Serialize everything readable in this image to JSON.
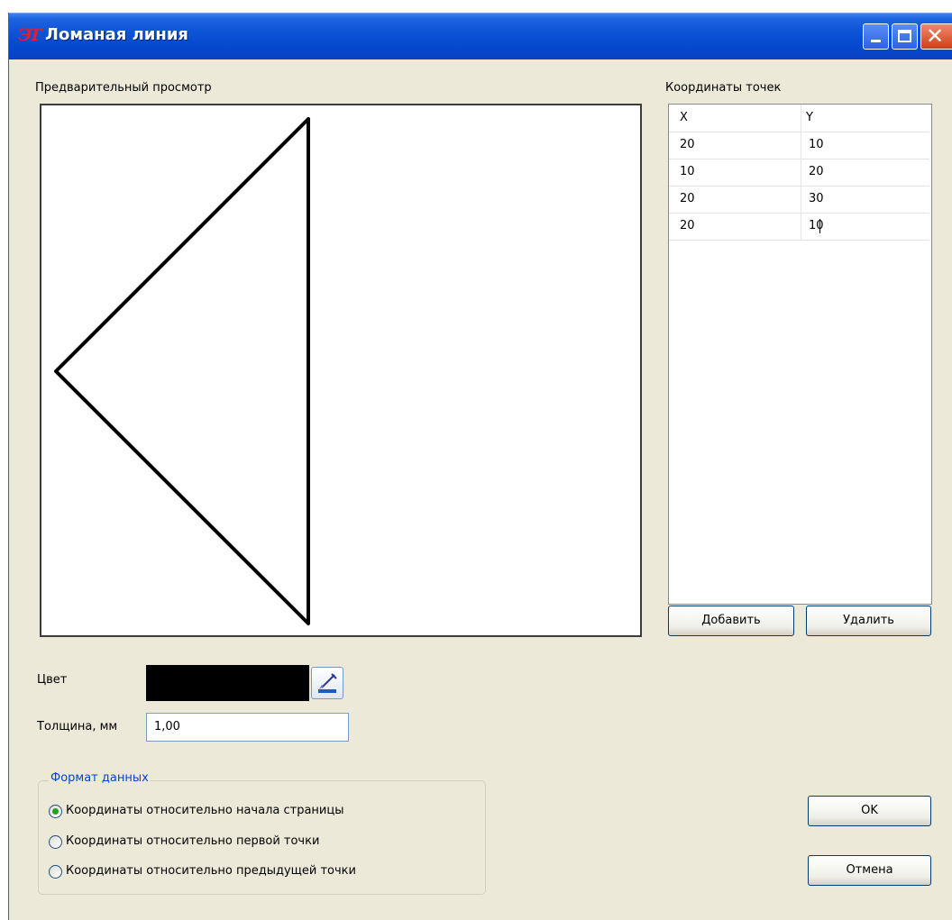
{
  "window": {
    "title": "Ломаная линия",
    "app_icon_glyph": "ЭТ",
    "buttons": {
      "minimize": "minimize-icon",
      "maximize": "maximize-icon",
      "close": "close-icon"
    }
  },
  "preview": {
    "label": "Предварительный просмотр",
    "stroke_color": "#000000"
  },
  "points": {
    "label": "Координаты точек",
    "columns": [
      "X",
      "Y"
    ],
    "rows": [
      {
        "x": "20",
        "y": "10"
      },
      {
        "x": "10",
        "y": "20"
      },
      {
        "x": "20",
        "y": "30"
      },
      {
        "x": "20",
        "y": "10"
      }
    ],
    "add_button": "Добавить",
    "delete_button": "Удалить"
  },
  "color": {
    "label": "Цвет",
    "value": "#000000",
    "picker_icon": "color-picker-icon"
  },
  "thickness": {
    "label": "Толщина, мм",
    "value": "1,00"
  },
  "data_format": {
    "title": "Формат данных",
    "options": [
      {
        "label": "Координаты относительно начала страницы",
        "selected": true
      },
      {
        "label": "Координаты относительно первой точки",
        "selected": false
      },
      {
        "label": "Координаты относительно предыдущей точки",
        "selected": false
      }
    ]
  },
  "actions": {
    "ok": "OK",
    "cancel": "Отмена"
  },
  "colors": {
    "titlebar": "#0a52d6",
    "window_bg": "#ece9d8",
    "group_title": "#0046d5",
    "radio_dot": "#21a121",
    "close_button": "#d23e18"
  }
}
